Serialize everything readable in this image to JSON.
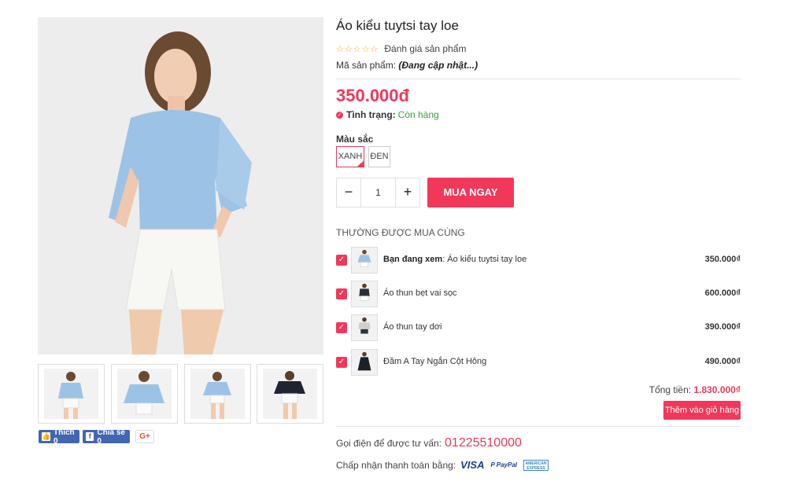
{
  "product": {
    "title": "Áo kiểu tuytsi tay loe",
    "rating_text": "Đánh giá sản phẩm",
    "stars": [
      "☆",
      "☆",
      "☆",
      "☆",
      "☆"
    ],
    "sku_label": "Mã sản phẩm:",
    "sku_value": "(Đang cập nhật...)",
    "price": "350.000đ",
    "status_label": "Tình trạng:",
    "status_value": "Còn hàng"
  },
  "colors": {
    "label": "Màu sắc",
    "options": [
      {
        "label": "XANH",
        "selected": true
      },
      {
        "label": "ĐEN",
        "selected": false
      }
    ]
  },
  "quantity": {
    "minus": "−",
    "value": "1",
    "plus": "+"
  },
  "buy_now": "MUA NGAY",
  "bundle": {
    "heading": "THƯỜNG ĐƯỢC MUA CÙNG",
    "items": [
      {
        "prefix": "Bạn đang xem",
        "name": ": Áo kiểu tuytsi tay loe",
        "price": "350.000₫",
        "checked": true
      },
      {
        "prefix": "",
        "name": "Áo thun bẹt vai sọc",
        "price": "600.000₫",
        "checked": true
      },
      {
        "prefix": "",
        "name": "Áo thun tay dơi",
        "price": "390.000₫",
        "checked": true
      },
      {
        "prefix": "",
        "name": "Đầm A Tay Ngắn Cột Hông",
        "price": "490.000₫",
        "checked": true
      }
    ],
    "total_label": "Tổng tiền:",
    "total_value": "1.830.000₫",
    "add_to_cart": "Thêm vào giỏ hàng"
  },
  "social": {
    "like": "Thích 0",
    "share": "Chia sẻ 0",
    "gplus": "G+"
  },
  "contact": {
    "label": "Gọi điện để được tư vấn:",
    "phone": "01225510000"
  },
  "payment": {
    "label": "Chấp nhận thanh toán bằng:",
    "visa": "VISA",
    "paypal": "P PayPal",
    "amex": "AMERICAN EXPRESS"
  },
  "colors_theme": {
    "accent": "#f2385a",
    "in_stock": "#3aa13a",
    "facebook": "#4267b2",
    "top_color": "#9cc3e6",
    "shorts_color": "#f7f7f4"
  }
}
